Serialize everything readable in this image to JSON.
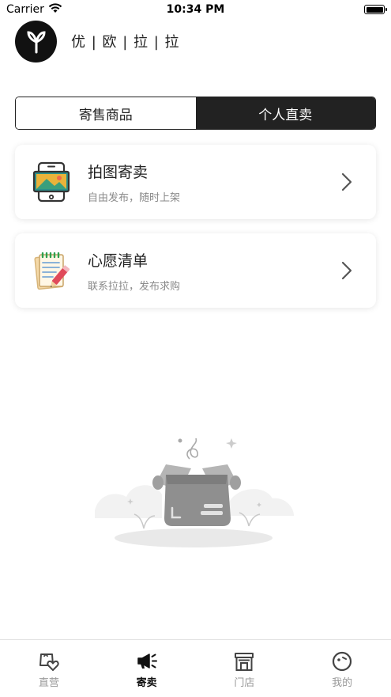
{
  "status_bar": {
    "carrier": "Carrier",
    "time": "10:34 PM"
  },
  "header": {
    "brand_title": "优 | 欧 | 拉 | 拉"
  },
  "segment": {
    "tabs": [
      {
        "label": "寄售商品",
        "active": false
      },
      {
        "label": "个人直卖",
        "active": true
      }
    ]
  },
  "cards": [
    {
      "title": "拍图寄卖",
      "subtitle": "自由发布，随时上架",
      "icon": "phone-photo-icon"
    },
    {
      "title": "心愿清单",
      "subtitle": "联系拉拉，发布求购",
      "icon": "notepad-pencil-icon"
    }
  ],
  "empty_state": {
    "icon": "empty-box-icon"
  },
  "tabbar": {
    "items": [
      {
        "label": "直营",
        "icon": "shopping-bag-heart-icon",
        "active": false
      },
      {
        "label": "寄卖",
        "icon": "megaphone-icon",
        "active": true
      },
      {
        "label": "门店",
        "icon": "store-icon",
        "active": false
      },
      {
        "label": "我的",
        "icon": "profile-face-icon",
        "active": false
      }
    ]
  },
  "colors": {
    "primary": "#222222",
    "muted_text": "#8a8a8a",
    "tab_inactive": "#999999"
  }
}
